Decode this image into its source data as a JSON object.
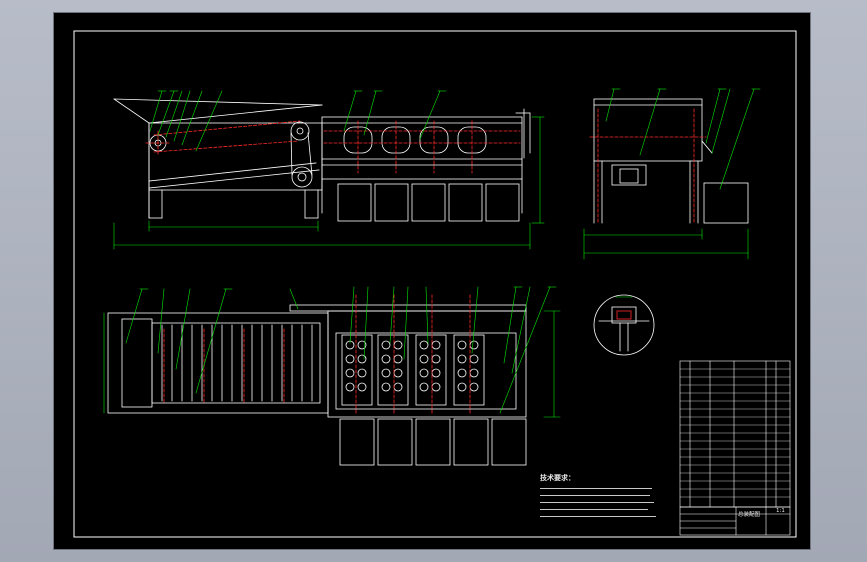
{
  "drawing": {
    "tech_requirements_title": "技术要求：",
    "title_block_name": "总装配图",
    "scale_label": "1:1",
    "colors": {
      "background": "#b3b8c4",
      "sheet": "#000000",
      "frame_line": "#ffffff",
      "geometry": "#ffffff",
      "centerline": "#ff2a2a",
      "leader": "#00e600"
    }
  }
}
